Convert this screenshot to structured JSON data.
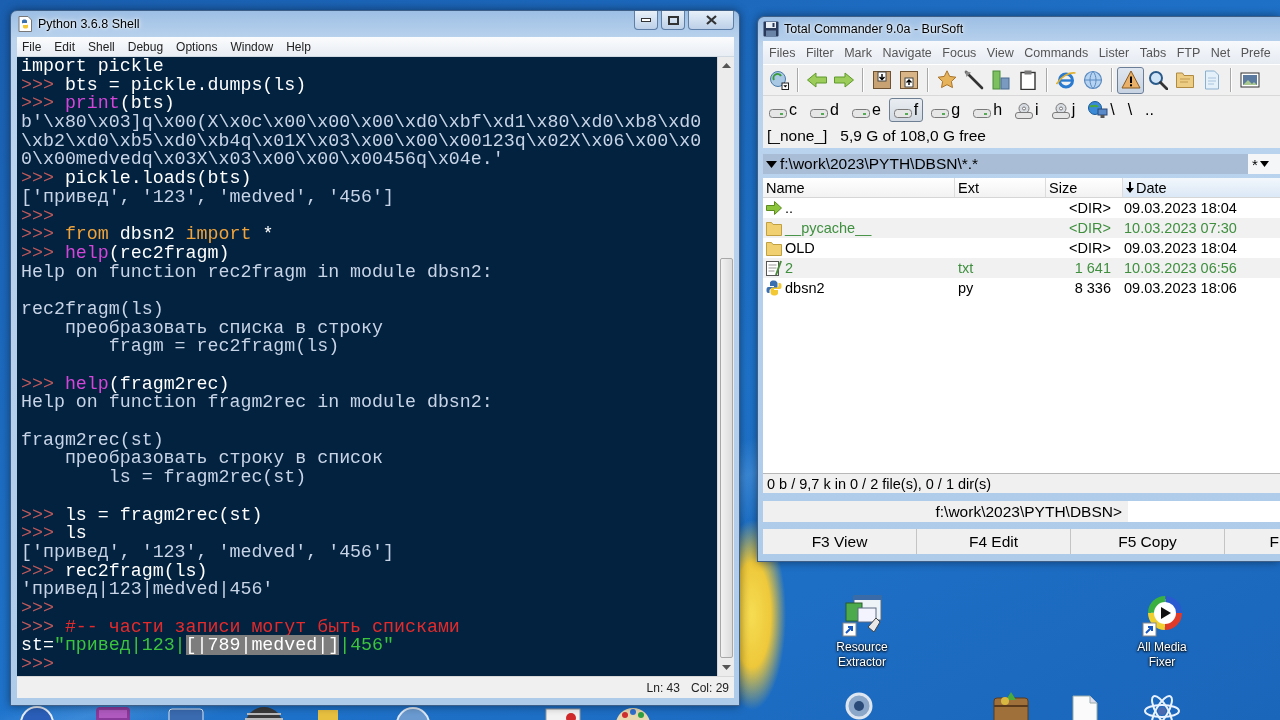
{
  "python_shell": {
    "title": "Python 3.6.8 Shell",
    "menu": [
      "File",
      "Edit",
      "Shell",
      "Debug",
      "Options",
      "Window",
      "Help"
    ],
    "lines": [
      {
        "kind": "text",
        "segments": [
          {
            "kind": "code",
            "text": "import pickle"
          }
        ]
      },
      {
        "kind": "text",
        "segments": [
          {
            "kind": "prompt",
            "text": ">>>"
          },
          {
            "kind": "code",
            "text": "bts = pickle.dumps(ls)"
          }
        ]
      },
      {
        "kind": "text",
        "segments": [
          {
            "kind": "prompt",
            "text": ">>>"
          },
          {
            "kind": "builtin",
            "text": "print"
          },
          {
            "kind": "code",
            "text": "(bts)"
          }
        ]
      },
      {
        "kind": "text",
        "segments": [
          {
            "kind": "output",
            "text": "b'\\x80\\x03]q\\x00(X\\x0c\\x00\\x00\\x00\\xd0\\xbf\\xd1\\x80\\xd0\\xb8\\xd0"
          }
        ]
      },
      {
        "kind": "text",
        "segments": [
          {
            "kind": "output",
            "text": "\\xb2\\xd0\\xb5\\xd0\\xb4q\\x01X\\x03\\x00\\x00\\x00123q\\x02X\\x06\\x00\\x0"
          }
        ]
      },
      {
        "kind": "text",
        "segments": [
          {
            "kind": "output",
            "text": "0\\x00medvedq\\x03X\\x03\\x00\\x00\\x00456q\\x04e.'"
          }
        ]
      },
      {
        "kind": "text",
        "segments": [
          {
            "kind": "prompt",
            "text": ">>>"
          },
          {
            "kind": "code",
            "text": "pickle.loads(bts)"
          }
        ]
      },
      {
        "kind": "text",
        "segments": [
          {
            "kind": "output",
            "text": "['привед', '123', 'medved', '456']"
          }
        ]
      },
      {
        "kind": "text",
        "segments": [
          {
            "kind": "prompt",
            "text": ">>>"
          }
        ]
      },
      {
        "kind": "text",
        "segments": [
          {
            "kind": "prompt",
            "text": ">>>"
          },
          {
            "kind": "keyword",
            "text": "from"
          },
          {
            "kind": "code",
            "text": " dbsn2 "
          },
          {
            "kind": "keyword",
            "text": "import"
          },
          {
            "kind": "code",
            "text": " *"
          }
        ]
      },
      {
        "kind": "text",
        "segments": [
          {
            "kind": "prompt",
            "text": ">>>"
          },
          {
            "kind": "builtin",
            "text": "help"
          },
          {
            "kind": "code",
            "text": "(rec2fragm)"
          }
        ]
      },
      {
        "kind": "text",
        "segments": [
          {
            "kind": "output",
            "text": "Help on function rec2fragm in module dbsn2:"
          }
        ]
      },
      {
        "kind": "blank"
      },
      {
        "kind": "text",
        "segments": [
          {
            "kind": "output",
            "text": "rec2fragm(ls)"
          }
        ]
      },
      {
        "kind": "text",
        "segments": [
          {
            "kind": "output",
            "text": "    преобразовать списка в строку"
          }
        ]
      },
      {
        "kind": "text",
        "segments": [
          {
            "kind": "output",
            "text": "        fragm = rec2fragm(ls)"
          }
        ]
      },
      {
        "kind": "blank"
      },
      {
        "kind": "text",
        "segments": [
          {
            "kind": "prompt",
            "text": ">>>"
          },
          {
            "kind": "builtin",
            "text": "help"
          },
          {
            "kind": "code",
            "text": "(fragm2rec)"
          }
        ]
      },
      {
        "kind": "text",
        "segments": [
          {
            "kind": "output",
            "text": "Help on function fragm2rec in module dbsn2:"
          }
        ]
      },
      {
        "kind": "blank"
      },
      {
        "kind": "text",
        "segments": [
          {
            "kind": "output",
            "text": "fragm2rec(st)"
          }
        ]
      },
      {
        "kind": "text",
        "segments": [
          {
            "kind": "output",
            "text": "    преобразовать строку в список"
          }
        ]
      },
      {
        "kind": "text",
        "segments": [
          {
            "kind": "output",
            "text": "        ls = fragm2rec(st)"
          }
        ]
      },
      {
        "kind": "blank"
      },
      {
        "kind": "text",
        "segments": [
          {
            "kind": "prompt",
            "text": ">>>"
          },
          {
            "kind": "code",
            "text": "ls = fragm2rec(st)"
          }
        ]
      },
      {
        "kind": "text",
        "segments": [
          {
            "kind": "prompt",
            "text": ">>>"
          },
          {
            "kind": "code",
            "text": "ls"
          }
        ]
      },
      {
        "kind": "text",
        "segments": [
          {
            "kind": "output",
            "text": "['привед', '123', 'medved', '456']"
          }
        ]
      },
      {
        "kind": "text",
        "segments": [
          {
            "kind": "prompt",
            "text": ">>>"
          },
          {
            "kind": "code",
            "text": "rec2fragm(ls)"
          }
        ]
      },
      {
        "kind": "text",
        "segments": [
          {
            "kind": "output",
            "text": "'привед|123|medved|456'"
          }
        ]
      },
      {
        "kind": "text",
        "segments": [
          {
            "kind": "prompt",
            "text": ">>>"
          }
        ]
      },
      {
        "kind": "text",
        "segments": [
          {
            "kind": "prompt",
            "text": ">>>"
          },
          {
            "kind": "comment",
            "text": "#-- части записи могут быть списками"
          }
        ]
      },
      {
        "kind": "text",
        "segments": [
          {
            "kind": "code",
            "text": "st="
          },
          {
            "kind": "string",
            "text": "\"привед|123|"
          },
          {
            "kind": "selection",
            "text": "[|789|medved|]"
          },
          {
            "kind": "string",
            "text": "|456\""
          }
        ]
      },
      {
        "kind": "text",
        "segments": [
          {
            "kind": "prompt",
            "text": ">>>"
          }
        ]
      }
    ],
    "status_bar": {
      "line": "Ln: 43",
      "column": "Col: 29"
    }
  },
  "total_commander": {
    "title": "Total Commander 9.0a - BurSoft",
    "menu": [
      "Files",
      "Filter",
      "Mark",
      "Navigate",
      "Focus",
      "View",
      "Commands",
      "Lister",
      "Tabs",
      "FTP",
      "Net",
      "Prefe"
    ],
    "toolbar": [
      {
        "pressed": false
      },
      {
        "pressed": false
      },
      {
        "pressed": false
      },
      {
        "pressed": false
      },
      {
        "pressed": false
      },
      {
        "pressed": false
      },
      {
        "pressed": false
      },
      {
        "pressed": false
      },
      {
        "pressed": false
      },
      {
        "pressed": false
      },
      {
        "pressed": false
      },
      {
        "pressed": true
      },
      {
        "pressed": false
      },
      {
        "pressed": false
      },
      {
        "pressed": false
      },
      {
        "pressed": false
      }
    ],
    "drives": [
      {
        "kind": "disk",
        "label": "c",
        "selected": false
      },
      {
        "kind": "disk",
        "label": "d",
        "selected": false
      },
      {
        "kind": "disk",
        "label": "e",
        "selected": false
      },
      {
        "kind": "disk",
        "label": "f",
        "selected": true
      },
      {
        "kind": "disk",
        "label": "g",
        "selected": false
      },
      {
        "kind": "disk",
        "label": "h",
        "selected": false
      },
      {
        "kind": "cd",
        "label": "i",
        "selected": false
      },
      {
        "kind": "cd",
        "label": "j",
        "selected": false
      },
      {
        "kind": "network",
        "label": "\\",
        "selected": false
      },
      {
        "kind": "plain",
        "label": "\\",
        "selected": false
      },
      {
        "kind": "plain",
        "label": "..",
        "selected": false
      }
    ],
    "drive_info": {
      "volume": "[_none_]",
      "free_space": "5,9 G of 108,0 G free"
    },
    "path": "f:\\work\\2023\\PYTH\\DBSN\\*.*",
    "filter": "*",
    "columns": [
      {
        "label": "Name",
        "sorted": false
      },
      {
        "label": "Ext",
        "sorted": false
      },
      {
        "label": "Size",
        "sorted": false
      },
      {
        "label": "Date",
        "sorted": true
      }
    ],
    "rows": [
      {
        "kind": "parent",
        "name": "..",
        "size": "<DIR>",
        "date": "09.03.2023 18:04",
        "color": "#000000"
      },
      {
        "kind": "folder",
        "name": "__pycache__",
        "size": "<DIR>",
        "date": "10.03.2023 07:30",
        "color": "#3f8f3f"
      },
      {
        "kind": "folder",
        "name": "OLD",
        "size": "<DIR>",
        "date": "09.03.2023 18:04",
        "color": "#000000"
      },
      {
        "kind": "text",
        "name": "2",
        "ext": "txt",
        "size": "1 641",
        "date": "10.03.2023 06:56",
        "color": "#3f8f3f"
      },
      {
        "kind": "script",
        "name": "dbsn2",
        "ext": "py",
        "size": "8 336",
        "date": "09.03.2023 18:06",
        "color": "#000000"
      }
    ],
    "status": "0 b / 9,7 k in 0 / 2 file(s), 0 / 1 dir(s)",
    "command_prompt": "f:\\work\\2023\\PYTH\\DBSN>",
    "function_keys": [
      "F3 View",
      "F4 Edit",
      "F5 Copy",
      "F"
    ]
  },
  "desktop_icons": [
    {
      "kind": "extractor",
      "label": "Resource Extractor"
    },
    {
      "kind": "media",
      "label": "All Media Fixer"
    }
  ]
}
